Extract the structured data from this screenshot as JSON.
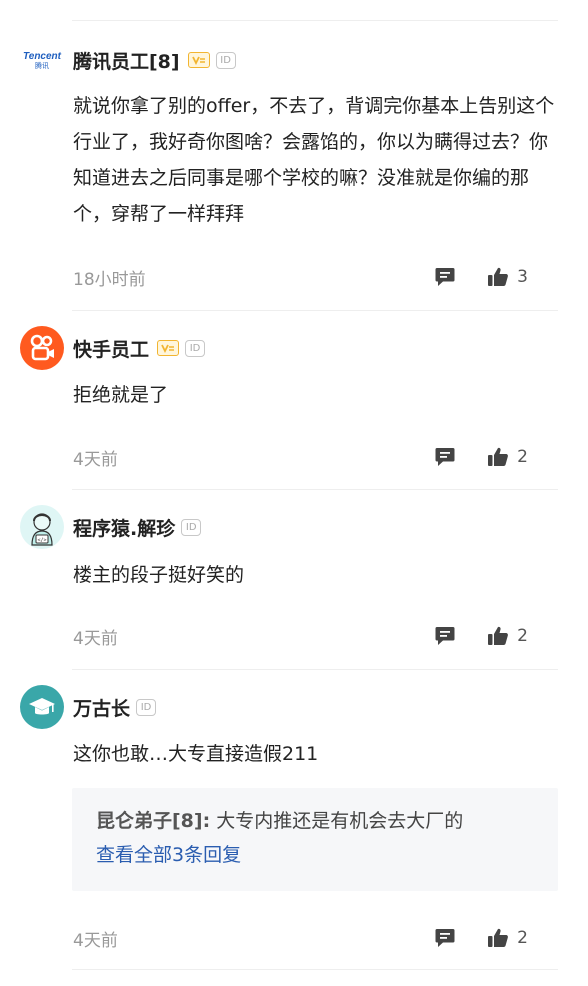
{
  "comments": [
    {
      "author": "腾讯员工[8]",
      "avatar_label": "Tencent",
      "avatar_sub": "腾讯",
      "has_vip": true,
      "id_badge": "ID",
      "text": "就说你拿了别的offer，不去了，背调完你基本上告别这个行业了，我好奇你图啥？会露馅的，你以为瞒得过去？你知道进去之后同事是哪个学校的嘛？没准就是你编的那个，穿帮了一样拜拜",
      "time": "18小时前",
      "likes": "3"
    },
    {
      "author": "快手员工",
      "has_vip": true,
      "id_badge": "ID",
      "text": "拒绝就是了",
      "time": "4天前",
      "likes": "2"
    },
    {
      "author": "程序猿.解珍",
      "has_vip": false,
      "id_badge": "ID",
      "text": "楼主的段子挺好笑的",
      "time": "4天前",
      "likes": "2"
    },
    {
      "author": "万古长",
      "has_vip": false,
      "id_badge": "ID",
      "text": "这你也敢…大专直接造假211",
      "time": "4天前",
      "likes": "2",
      "sub_reply": {
        "author": "昆仑弟子[8]:",
        "text": " 大专内推还是有机会去大厂的",
        "more": "查看全部3条回复"
      }
    }
  ],
  "colors": {
    "kuaishou": "#ff5a1f",
    "teal": "#3aa7a9",
    "link": "#2a5db0",
    "vip": "#f2b531"
  },
  "icons": {
    "reply": "comment-bubble-icon",
    "like": "thumbs-up-icon",
    "vip": "vip-badge-icon"
  }
}
